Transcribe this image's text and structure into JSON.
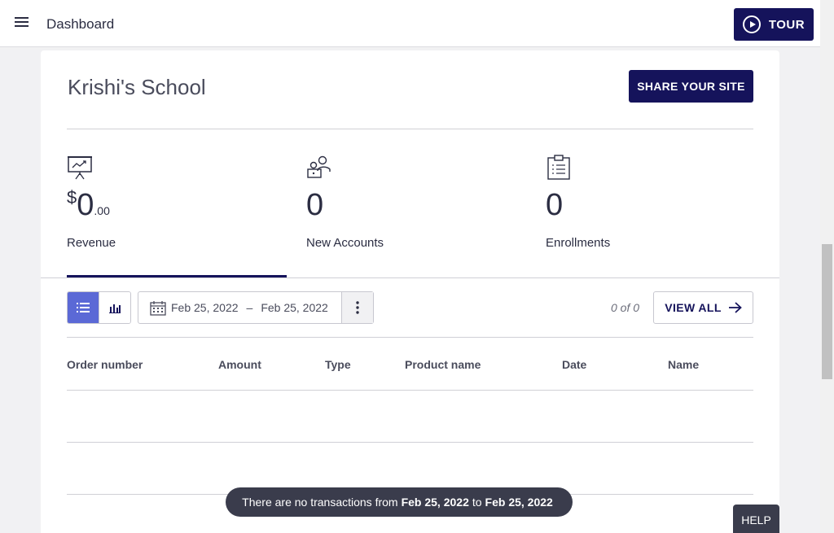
{
  "topbar": {
    "title": "Dashboard",
    "tour_label": "TOUR"
  },
  "school": {
    "name": "Krishi's School",
    "share_label": "SHARE YOUR SITE"
  },
  "stats": {
    "revenue": {
      "currency": "$",
      "value": "0",
      "cents": ".00",
      "label": "Revenue"
    },
    "accounts": {
      "value": "0",
      "label": "New Accounts"
    },
    "enrollments": {
      "value": "0",
      "label": "Enrollments"
    }
  },
  "toolbar": {
    "date_from": "Feb 25, 2022",
    "date_sep": "–",
    "date_to": "Feb 25, 2022",
    "count": "0 of 0",
    "view_all_label": "VIEW ALL"
  },
  "table": {
    "headers": [
      "Order number",
      "Amount",
      "Type",
      "Product name",
      "Date",
      "Name"
    ]
  },
  "toast": {
    "prefix": "There are no transactions from",
    "from": "Feb 25, 2022",
    "middle": "to",
    "to": "Feb 25, 2022"
  },
  "help_label": "HELP",
  "colors": {
    "accent": "#15135b",
    "toggle_active": "#5b69d6",
    "toast_bg": "#3a3c4c"
  }
}
